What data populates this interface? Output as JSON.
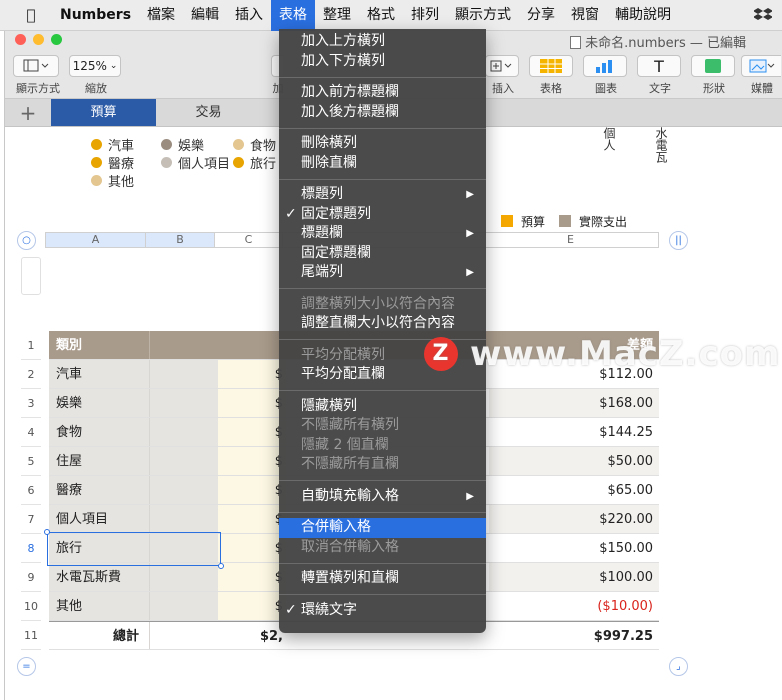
{
  "menubar": {
    "app": "Numbers",
    "items": [
      "檔案",
      "編輯",
      "插入",
      "表格",
      "整理",
      "格式",
      "排列",
      "顯示方式",
      "分享",
      "視窗",
      "輔助說明"
    ],
    "active_index": 3
  },
  "window": {
    "doc_title": "未命名.numbers — 已編輯"
  },
  "toolbar": {
    "view_label": "顯示方式",
    "zoom_value": "125%",
    "zoom_label": "縮放",
    "add_label": "加",
    "insert_label": "插入",
    "table_label": "表格",
    "chart_label": "圖表",
    "text_label": "文字",
    "shape_label": "形狀",
    "media_label": "媒體",
    "text_glyph": "T"
  },
  "sheettabs": {
    "plus": "+",
    "tabs": [
      "預算",
      "交易"
    ]
  },
  "legend": {
    "row1": [
      "汽車",
      "娛樂",
      "食物"
    ],
    "row2": [
      "醫療",
      "個人項目",
      "旅行"
    ],
    "row3": [
      "其他"
    ],
    "right_v1": "個人",
    "right_v2": "水電瓦"
  },
  "legend2": [
    "預算",
    "實際支出"
  ],
  "colhdr": [
    "A",
    "B",
    "C",
    "E"
  ],
  "table": {
    "header": {
      "category": "類別",
      "diff": "差額"
    },
    "rows": [
      {
        "num": "2",
        "cat": "汽車",
        "c": "$",
        "diff": "$112.00"
      },
      {
        "num": "3",
        "cat": "娛樂",
        "c": "$",
        "diff": "$168.00"
      },
      {
        "num": "4",
        "cat": "食物",
        "c": "$",
        "diff": "$144.25"
      },
      {
        "num": "5",
        "cat": "住屋",
        "c": "$",
        "diff": "$50.00"
      },
      {
        "num": "6",
        "cat": "醫療",
        "c": "$",
        "diff": "$65.00"
      },
      {
        "num": "7",
        "cat": "個人項目",
        "c": "$",
        "diff": "$220.00"
      },
      {
        "num": "8",
        "cat": "旅行",
        "c": "$",
        "diff": "$150.00"
      },
      {
        "num": "9",
        "cat": "水電瓦斯費",
        "c": "$",
        "diff": "$100.00"
      },
      {
        "num": "10",
        "cat": "其他",
        "c": "$",
        "diff": "($10.00)"
      }
    ],
    "total": {
      "num": "11",
      "label": "總計",
      "c": "$2,",
      "diff": "$997.25"
    },
    "header_num": "1"
  },
  "menu": {
    "items": [
      {
        "label": "加入上方橫列"
      },
      {
        "label": "加入下方橫列"
      },
      {
        "label": "加入前方標題欄"
      },
      {
        "label": "加入後方標題欄"
      },
      {
        "label": "刪除橫列"
      },
      {
        "label": "刪除直欄"
      },
      {
        "label": "標題列"
      },
      {
        "label": "固定標題列"
      },
      {
        "label": "標題欄"
      },
      {
        "label": "固定標題欄"
      },
      {
        "label": "尾端列"
      },
      {
        "label": "調整橫列大小以符合內容"
      },
      {
        "label": "調整直欄大小以符合內容"
      },
      {
        "label": "平均分配橫列"
      },
      {
        "label": "平均分配直欄"
      },
      {
        "label": "隱藏橫列"
      },
      {
        "label": "不隱藏所有橫列"
      },
      {
        "label": "隱藏 2 個直欄"
      },
      {
        "label": "不隱藏所有直欄"
      },
      {
        "label": "自動填充輸入格"
      },
      {
        "label": "合併輸入格"
      },
      {
        "label": "取消合併輸入格"
      },
      {
        "label": "轉置橫列和直欄"
      },
      {
        "label": "環繞文字"
      }
    ],
    "check_glyph": "✓",
    "arrow_glyph": "▶"
  },
  "watermark": {
    "z": "Z",
    "text": "www.MacZ.com"
  },
  "colors": {
    "accent": "#2a6fe0",
    "header": "#a99b8b",
    "negative": "#d9231c"
  }
}
